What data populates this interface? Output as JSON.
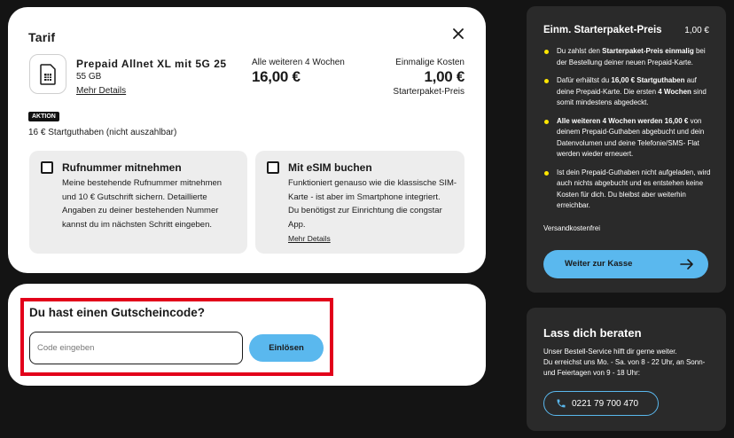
{
  "tarif": {
    "title": "Tarif",
    "product_name": "Prepaid Allnet XL mit 5G 25",
    "product_data": "55 GB",
    "details_link": "Mehr Details",
    "recurring_label": "Alle weiteren 4 Wochen",
    "recurring_price": "16,00 €",
    "onetime_label": "Einmalige Kosten",
    "onetime_price": "1,00 €",
    "onetime_sub": "Starterpaket-Preis",
    "badge": "AKTION",
    "start_credit": "16 € Startguthaben (nicht auszahlbar)",
    "options": [
      {
        "title": "Rufnummer mitnehmen",
        "lines": [
          "Meine bestehende Rufnummer mitnehmen",
          "und 10 € Gutschrift sichern. Detaillierte",
          "Angaben zu deiner bestehenden Nummer",
          "kannst du im nächsten Schritt eingeben."
        ]
      },
      {
        "title": "Mit eSIM buchen",
        "lines": [
          "Funktioniert genauso wie die klassische SIM-",
          "Karte - ist aber im Smartphone integriert.",
          "Du benötigst zur Einrichtung die congstar",
          "App."
        ],
        "link": "Mehr Details"
      }
    ]
  },
  "voucher": {
    "title": "Du hast einen Gutscheincode?",
    "placeholder": "Code eingeben",
    "button": "Einlösen",
    "highlight_color": "#e2001a"
  },
  "summary": {
    "title": "Einm. Starterpaket-Preis",
    "price": "1,00 €",
    "bullets": [
      [
        "Du zahlst den ",
        "Starterpaket-Preis einmalig",
        " bei der Bestellung deiner neuen Prepaid-Karte."
      ],
      [
        "Dafür erhältst du ",
        "16,00 € Startguthaben",
        " auf deine Prepaid-Karte. Die ersten ",
        "4 Wochen",
        " sind somit mindestens abgedeckt."
      ],
      [
        "",
        "Alle weiteren 4 Wochen werden 16,00 €",
        " von deinem Prepaid-Guthaben abgebucht und dein Datenvolumen und deine Telefonie/SMS- Flat werden wieder erneuert."
      ],
      [
        "Ist dein Prepaid-Guthaben nicht aufgeladen, wird auch nichts abgebucht und es entstehen keine Kosten für dich. Du bleibst aber weiterhin erreichbar."
      ]
    ],
    "shipping": "Versandkostenfrei",
    "checkout_button": "Weiter zur Kasse",
    "bullet_color": "#ffe600"
  },
  "advice": {
    "title": "Lass dich beraten",
    "lines": [
      "Unser Bestell-Service hilft dir gerne weiter.",
      "Du erreichst uns Mo. - Sa. von 8 - 22 Uhr, an Sonn-",
      "und Feiertagen von 9 - 18 Uhr:"
    ],
    "phone": "0221 79 700 470",
    "accent_color": "#5ab8ee"
  }
}
